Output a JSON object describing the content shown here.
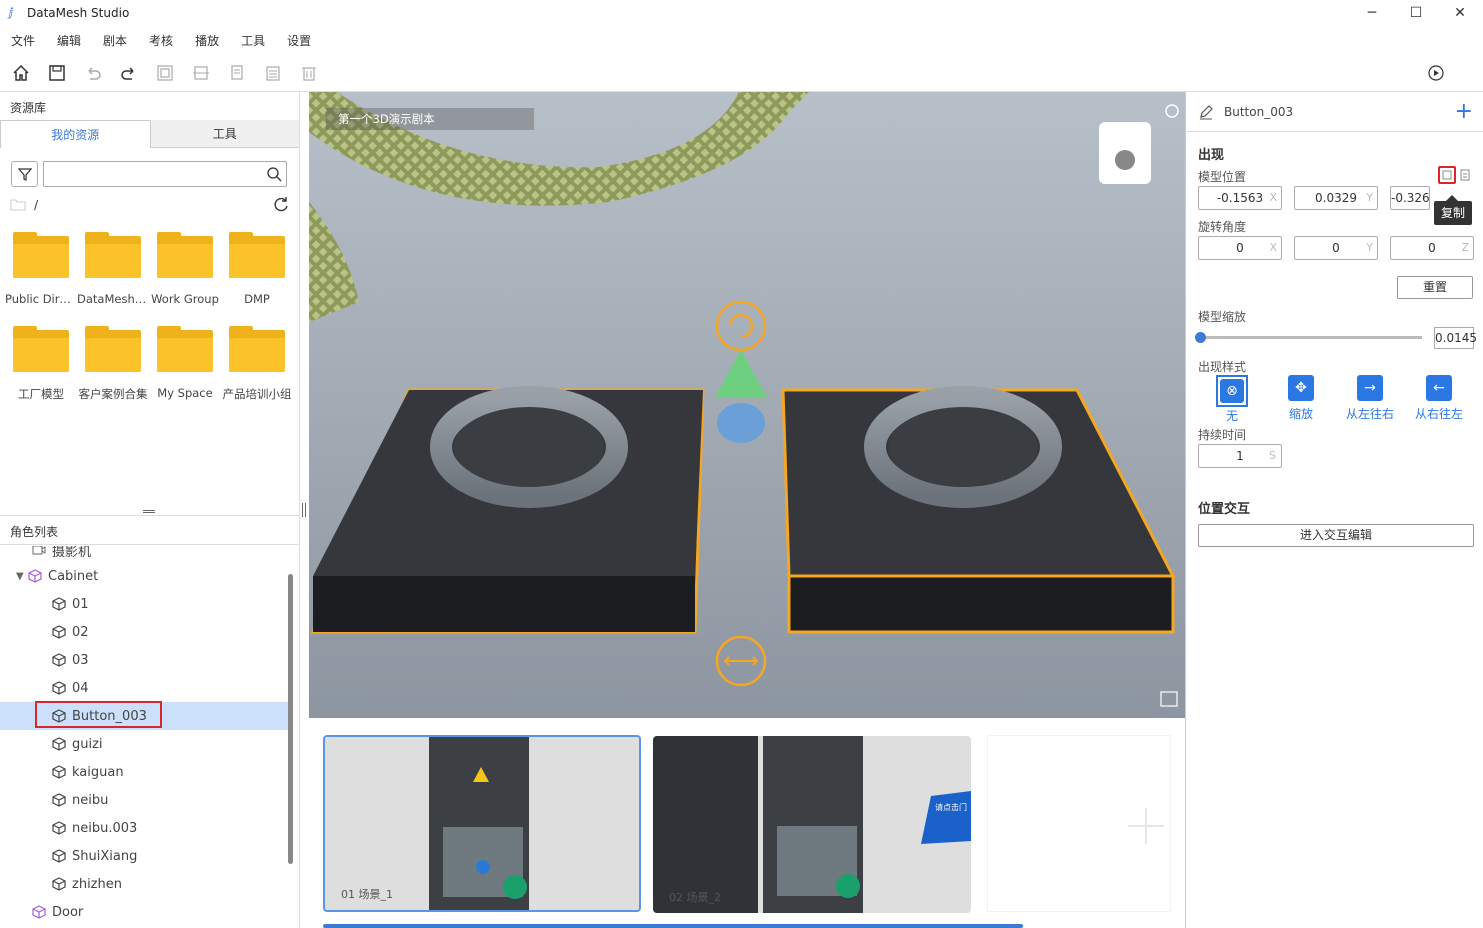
{
  "app": {
    "title": "DataMesh Studio",
    "minimize": "─",
    "maximize": "☐",
    "close": "✕"
  },
  "menu": [
    "文件",
    "编辑",
    "剧本",
    "考核",
    "播放",
    "工具",
    "设置"
  ],
  "toolbar": {
    "icons": [
      "home-icon",
      "save-icon",
      "undo-icon",
      "redo-icon",
      "group-icon",
      "align-icon",
      "copy-icon",
      "paste-icon",
      "delete-icon",
      "play-icon"
    ]
  },
  "left": {
    "resource_title": "资源库",
    "tabs": [
      "我的资源",
      "工具"
    ],
    "search_placeholder": "",
    "path": "/",
    "folders": [
      "Public Dire···",
      "DataMesh ···",
      "Work Group",
      "DMP",
      "工厂模型",
      "客户案例合集",
      "My Space",
      "产品培训小组"
    ],
    "role_title": "角色列表",
    "tree": [
      {
        "label": "摄影机",
        "indent": 1
      },
      {
        "label": "Cabinet",
        "indent": 1
      },
      {
        "label": "01",
        "indent": 2
      },
      {
        "label": "02",
        "indent": 2
      },
      {
        "label": "03",
        "indent": 2
      },
      {
        "label": "04",
        "indent": 2
      },
      {
        "label": "Button_003",
        "indent": 2
      },
      {
        "label": "guizi",
        "indent": 2
      },
      {
        "label": "kaiguan",
        "indent": 2
      },
      {
        "label": "neibu",
        "indent": 2
      },
      {
        "label": "neibu.003",
        "indent": 2
      },
      {
        "label": "ShuiXiang",
        "indent": 2
      },
      {
        "label": "zhizhen",
        "indent": 2
      },
      {
        "label": "Door",
        "indent": 1
      }
    ]
  },
  "viewport": {
    "scene_label": "第一个3D演示剧本"
  },
  "scenes": [
    {
      "label": "01  场景_1",
      "selected": true
    },
    {
      "label": "02  场景_2",
      "selected": false
    }
  ],
  "scene2_panel_text": "请点击门",
  "right": {
    "object_name": "Button_003",
    "section_appear": "出现",
    "label_position": "模型位置",
    "position": {
      "x": "-0.1563",
      "y": "0.0329",
      "z": "-0.326"
    },
    "label_rotation": "旋转角度",
    "rotation": {
      "x": "0",
      "y": "0",
      "z": "0"
    },
    "axis": {
      "x": "X",
      "y": "Y",
      "z": "Z"
    },
    "reset": "重置",
    "label_scale": "模型缩放",
    "scale": "0.0145",
    "scale_fraction": 0.0,
    "label_style": "出现样式",
    "styles": [
      "无",
      "缩放",
      "从左往右",
      "从右往左"
    ],
    "label_duration": "持续时间",
    "duration": "1",
    "duration_unit": "S",
    "section_interaction": "位置交互",
    "interaction_button": "进入交互编辑",
    "tooltip": "复制"
  },
  "colors": {
    "accent": "#2b78e4",
    "highlight": "#d9262c",
    "selection": "#cde0fb",
    "folder": "#fcc22a",
    "gizmo": "#f5a623"
  }
}
